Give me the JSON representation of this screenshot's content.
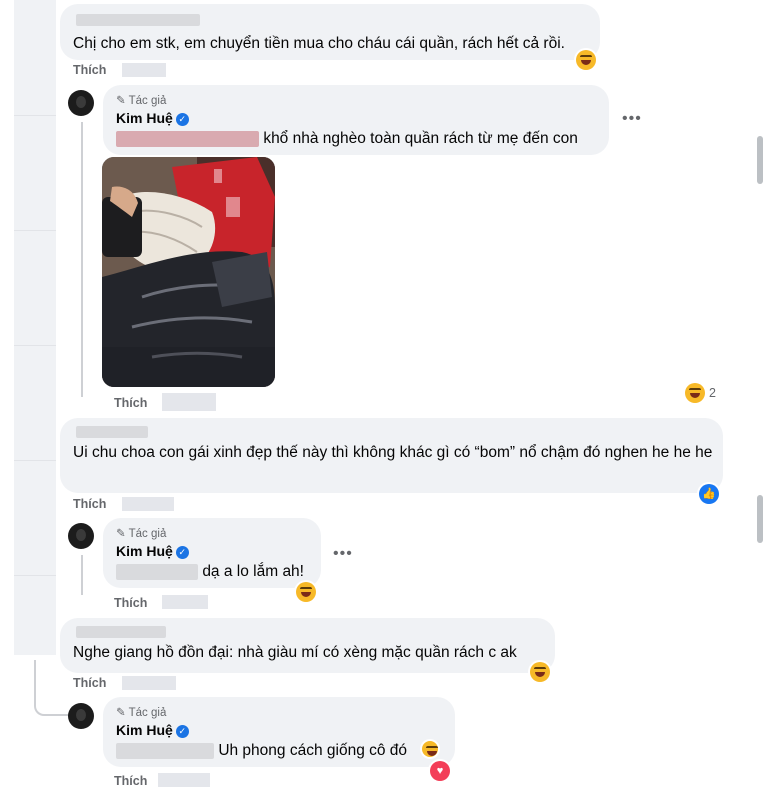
{
  "like_label": "Thích",
  "author_badge": "Tác giả",
  "author_name": "Kim Huệ",
  "more_glyph": "•••",
  "comments": [
    {
      "text": "Chị cho em stk, em chuyển tiền mua cho cháu cái quần, rách hết cả rồi."
    },
    {
      "text": "khổ nhà nghèo toàn quần rách từ mẹ đến con",
      "reaction_count": "2"
    },
    {
      "text": "Ui chu choa con gái xinh đẹp thế này thì không khác gì có “bom” nổ chậm đó nghen he he he"
    },
    {
      "text": "dạ a lo lắm ah!"
    },
    {
      "text": "Nghe giang hồ đồn đại: nhà giàu mí có xèng mặc quần rách c ak"
    },
    {
      "text": "Uh phong cách giống cô đó"
    }
  ],
  "icons": {
    "laugh": "laughing-emoji-icon",
    "like": "like-reaction-icon",
    "heart": "heart-reaction-icon",
    "pen": "pen-icon",
    "verified": "verified-badge-icon"
  },
  "colors": {
    "accent": "#1877f2",
    "bubble": "#f0f2f5",
    "meta": "#65676b",
    "heart": "#f33e58"
  }
}
